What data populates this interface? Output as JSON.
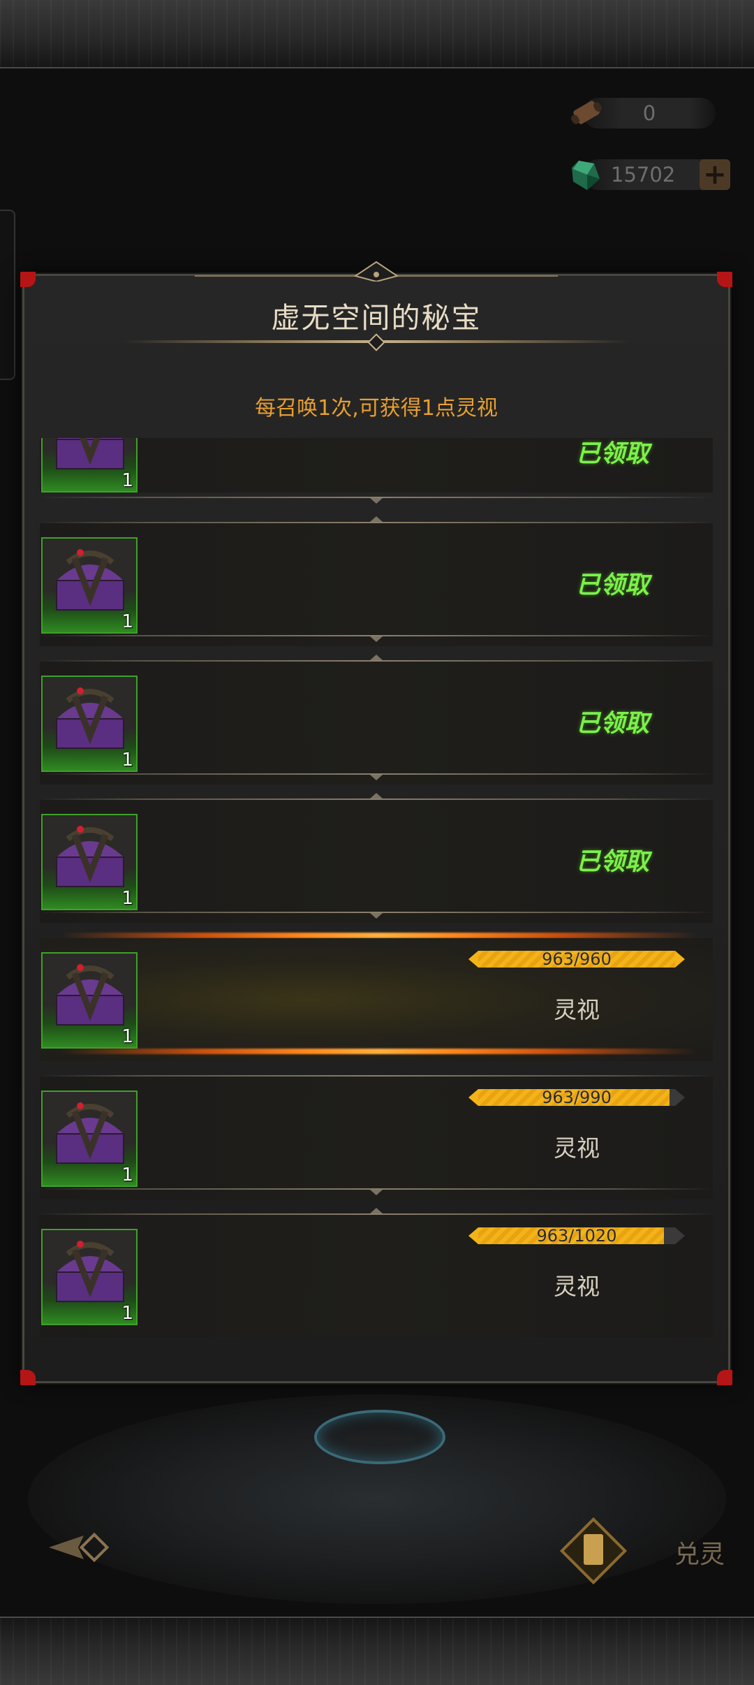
{
  "currencies": [
    {
      "id": "scroll",
      "icon": "scroll-icon",
      "value": "0"
    },
    {
      "id": "gem",
      "icon": "green-gem-icon",
      "value": "15702",
      "add_icon": "plus-icon"
    }
  ],
  "modal": {
    "title": "虚无空间的秘宝",
    "subtitle": "每召唤1次,可获得1点灵视"
  },
  "rewards": [
    {
      "count": "1",
      "status": "已领取"
    },
    {
      "count": "1",
      "status": "已领取"
    },
    {
      "count": "1",
      "status": "已领取"
    },
    {
      "count": "1",
      "status": "已领取"
    },
    {
      "count": "1",
      "progress_text": "963/960",
      "progress": 1.0,
      "label": "灵视"
    },
    {
      "count": "1",
      "progress_text": "963/990",
      "progress": 0.973,
      "label": "灵视"
    },
    {
      "count": "1",
      "progress_text": "963/1020",
      "progress": 0.944,
      "label": "灵视"
    }
  ],
  "bottom": {
    "back_icon": "back-arrow-icon",
    "exchange_icon": "card-icon",
    "exchange_label": "兑灵"
  },
  "colors": {
    "claimed": "#7cf04a",
    "progress": "#f2b418",
    "subtitle": "#e8a030",
    "title": "#e8dcc6"
  }
}
